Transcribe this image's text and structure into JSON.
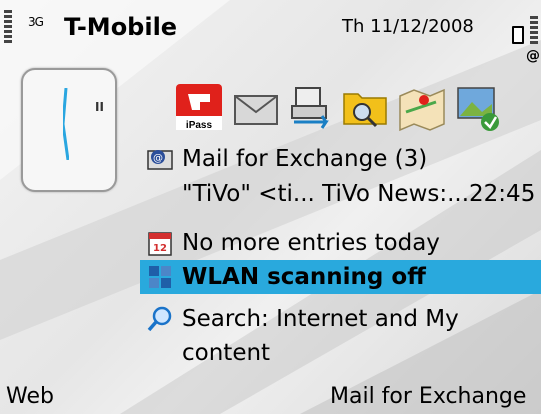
{
  "status_bar": {
    "network_indicator": "3G",
    "operator": "T-Mobile",
    "date": "Th 11/12/2008"
  },
  "clock": {
    "icon": "analog-clock-icon",
    "pause_indicator": "II"
  },
  "shortcuts": [
    {
      "name": "iPass",
      "label": "iPass",
      "icon": "ipass-icon"
    },
    {
      "name": "messaging",
      "icon": "envelope-icon"
    },
    {
      "name": "sync",
      "icon": "sync-icon"
    },
    {
      "name": "file-manager",
      "icon": "folder-search-icon"
    },
    {
      "name": "maps",
      "icon": "map-icon"
    },
    {
      "name": "gallery",
      "icon": "gallery-icon"
    }
  ],
  "notifications": {
    "mail": {
      "title": "Mail for Exchange (3)",
      "preview": "\"TiVo\" <ti... TiVo News:...22:45",
      "icon": "mail-exchange-icon"
    },
    "calendar": {
      "text": "No more entries today",
      "icon": "calendar-icon",
      "day": "12"
    },
    "wlan": {
      "text": "WLAN scanning off",
      "icon": "wlan-icon"
    },
    "search": {
      "line1": "Search: Internet and My",
      "line2": "content",
      "icon": "search-icon"
    }
  },
  "softkeys": {
    "left": "Web",
    "right": "Mail for Exchange"
  },
  "colors": {
    "selection": "#29a9dd"
  }
}
